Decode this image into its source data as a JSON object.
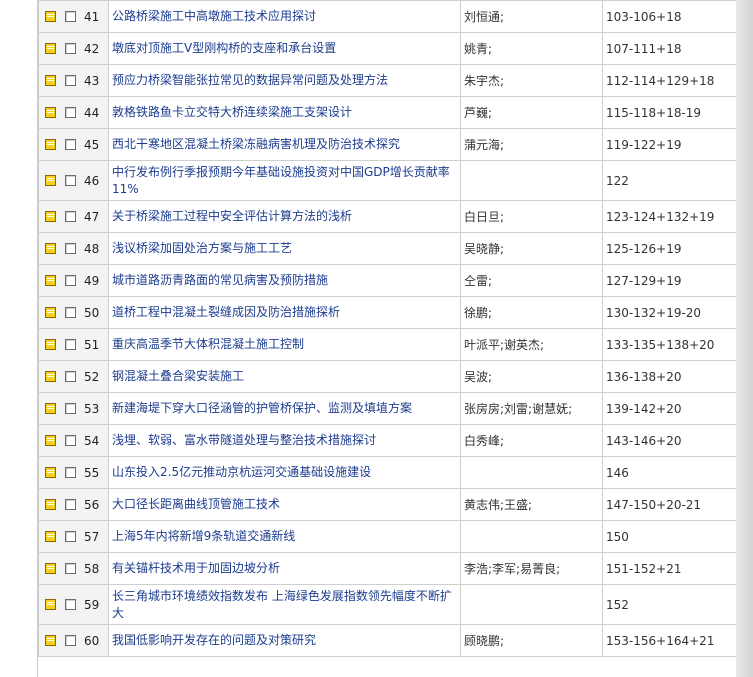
{
  "articles": [
    {
      "num": "41",
      "title": "公路桥梁施工中高墩施工技术应用探讨",
      "author": "刘恒通;",
      "pages": "103-106+18"
    },
    {
      "num": "42",
      "title": "墩底对顶施工V型刚构桥的支座和承台设置",
      "author": "姚青;",
      "pages": "107-111+18"
    },
    {
      "num": "43",
      "title": "预应力桥梁智能张拉常见的数据异常问题及处理方法",
      "author": "朱宇杰;",
      "pages": "112-114+129+18"
    },
    {
      "num": "44",
      "title": "敦格铁路鱼卡立交特大桥连续梁施工支架设计",
      "author": "芦巍;",
      "pages": "115-118+18-19"
    },
    {
      "num": "45",
      "title": "西北干寒地区混凝土桥梁冻融病害机理及防治技术探究",
      "author": "蒲元海;",
      "pages": "119-122+19"
    },
    {
      "num": "46",
      "title": "中行发布例行季报预期今年基础设施投资对中国GDP增长贡献率11%",
      "author": "",
      "pages": "122"
    },
    {
      "num": "47",
      "title": "关于桥梁施工过程中安全评估计算方法的浅析",
      "author": "白日旦;",
      "pages": "123-124+132+19"
    },
    {
      "num": "48",
      "title": "浅议桥梁加固处治方案与施工工艺",
      "author": "吴晓静;",
      "pages": "125-126+19"
    },
    {
      "num": "49",
      "title": "城市道路沥青路面的常见病害及预防措施",
      "author": "仝雷;",
      "pages": "127-129+19"
    },
    {
      "num": "50",
      "title": "道桥工程中混凝土裂缝成因及防治措施探析",
      "author": "徐鹏;",
      "pages": "130-132+19-20"
    },
    {
      "num": "51",
      "title": "重庆高温季节大体积混凝土施工控制",
      "author": "叶派平;谢英杰;",
      "pages": "133-135+138+20"
    },
    {
      "num": "52",
      "title": "钢混凝土叠合梁安装施工",
      "author": "吴波;",
      "pages": "136-138+20"
    },
    {
      "num": "53",
      "title": "新建海堤下穿大口径涵管的护管桥保护、监测及填埴方案",
      "author": "张房房;刘雷;谢慧妩;",
      "pages": "139-142+20"
    },
    {
      "num": "54",
      "title": "浅埋、软弱、富水带隧道处理与整治技术措施探讨",
      "author": "白秀峰;",
      "pages": "143-146+20"
    },
    {
      "num": "55",
      "title": "山东投入2.5亿元推动京杭运河交通基础设施建设",
      "author": "",
      "pages": "146"
    },
    {
      "num": "56",
      "title": "大口径长距离曲线顶管施工技术",
      "author": "黄志伟;王盛;",
      "pages": "147-150+20-21"
    },
    {
      "num": "57",
      "title": "上海5年内将新增9条轨道交通新线",
      "author": "",
      "pages": "150"
    },
    {
      "num": "58",
      "title": "有关锚杆技术用于加固边坡分析",
      "author": "李浩;李军;易菁良;",
      "pages": "151-152+21"
    },
    {
      "num": "59",
      "title": "长三角城市环境绩效指数发布 上海绿色发展指数领先幅度不断扩大",
      "author": "",
      "pages": "152"
    },
    {
      "num": "60",
      "title": "我国低影响开发存在的问题及对策研究",
      "author": "顾晓鹏;",
      "pages": "153-156+164+21"
    }
  ]
}
